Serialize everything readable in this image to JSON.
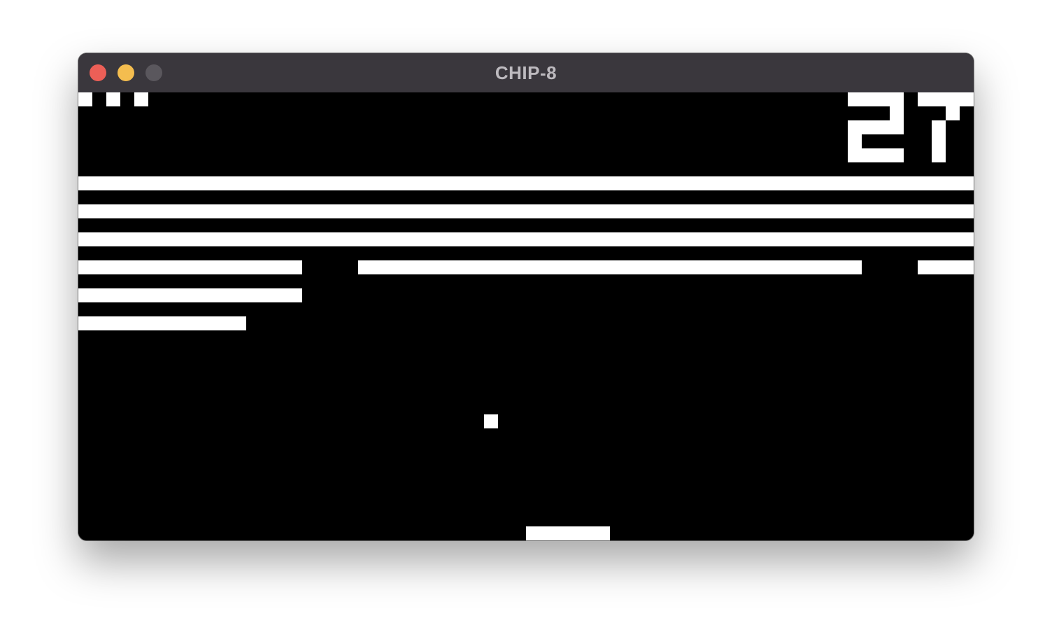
{
  "window": {
    "title": "CHIP-8",
    "controls": {
      "close_color": "#ec5f57",
      "minimize_color": "#f4bd4f",
      "zoom_color": "#5a575d"
    }
  },
  "display": {
    "resolution": [
      64,
      32
    ],
    "foreground": "#ffffff",
    "background": "#000000"
  },
  "game": {
    "score": "27",
    "lives_remaining": 3
  }
}
